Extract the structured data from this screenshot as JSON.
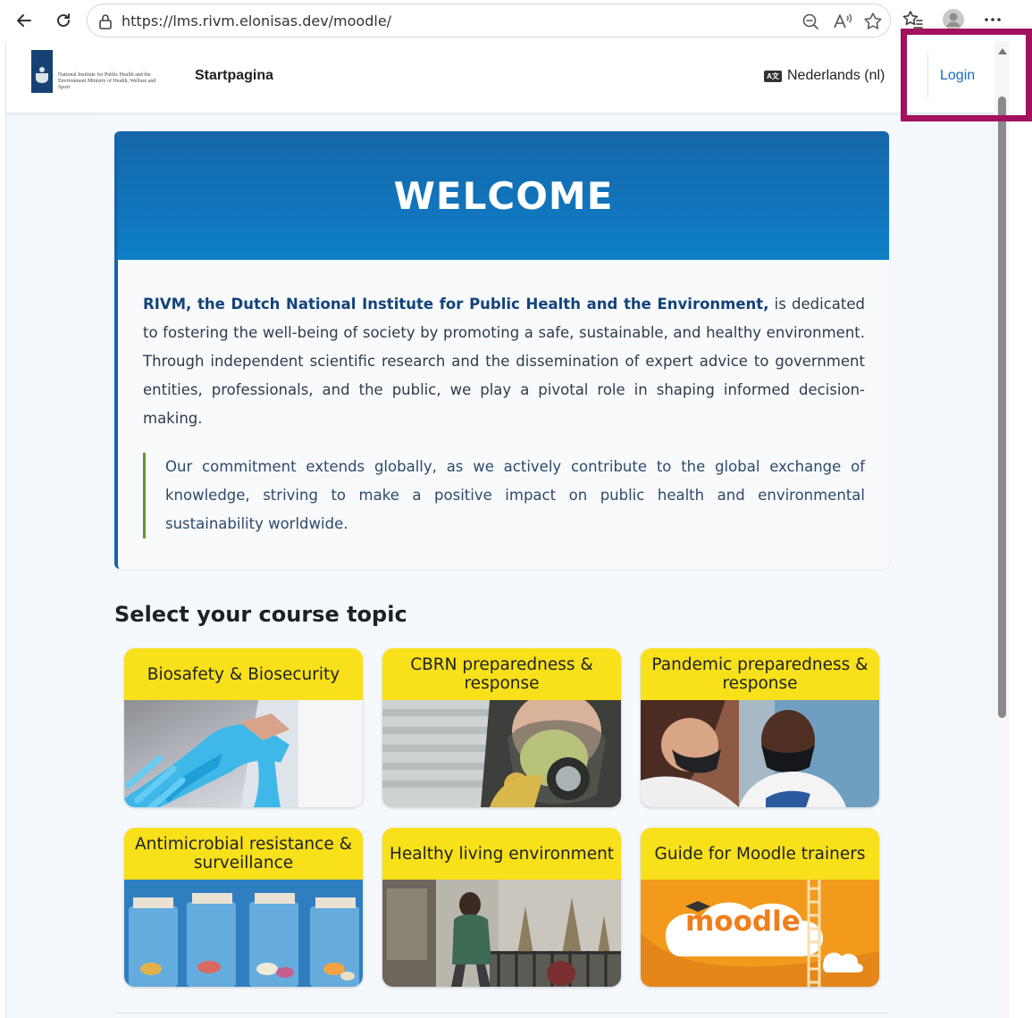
{
  "browser": {
    "url": "https://lms.rivm.elonisas.dev/moodle/"
  },
  "header": {
    "logo_text": "National Institute for Public Health and the Environment Ministry of Health, Welfare and Sport",
    "home_label": "Startpagina",
    "language_label": "Nederlands (nl)",
    "login_label": "Login"
  },
  "welcome": {
    "title": "WELCOME",
    "intro_bold": "RIVM, the Dutch National Institute for Public Health and the Environment,",
    "intro_rest": " is dedicated to fostering the well-being of society by promoting a safe, sustainable, and healthy environment. Through independent scientific research and the dissemination of expert advice to government entities, professionals, and the public, we play a pivotal role in shaping informed decision-making.",
    "quote": "Our commitment extends globally, as we actively contribute to the global exchange of knowledge, striving to make a positive impact on public health and environmental sustainability worldwide."
  },
  "courses": {
    "title": "Select your course topic",
    "items": [
      {
        "label": "Biosafety & Biosecurity"
      },
      {
        "label": "CBRN preparedness & response"
      },
      {
        "label": "Pandemic preparedness & response"
      },
      {
        "label": "Antimicrobial resistance & surveillance"
      },
      {
        "label": "Healthy living environment"
      },
      {
        "label": "Guide for Moodle trainers",
        "image_text": "moodle"
      }
    ]
  },
  "colors": {
    "brand_blue": "#154273",
    "banner_blue": "#1566a9",
    "tile_yellow": "#f8e01a",
    "link_blue": "#0f6cbf",
    "highlight": "#a3115f"
  }
}
